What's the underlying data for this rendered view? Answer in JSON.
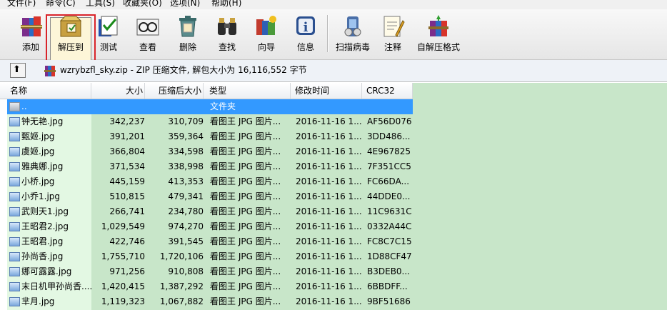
{
  "menu": [
    "文件(F)",
    "命令(C)",
    "工具(S)",
    "收藏夹(O)",
    "选项(N)",
    "帮助(H)"
  ],
  "toolbar": [
    {
      "label": "添加",
      "icon": "add-archive-icon"
    },
    {
      "label": "解压到",
      "icon": "extract-to-icon"
    },
    {
      "label": "测试",
      "icon": "test-icon"
    },
    {
      "label": "查看",
      "icon": "view-icon"
    },
    {
      "label": "删除",
      "icon": "delete-icon"
    },
    {
      "label": "查找",
      "icon": "find-icon"
    },
    {
      "label": "向导",
      "icon": "wizard-icon"
    },
    {
      "label": "信息",
      "icon": "info-icon"
    },
    {
      "label": "扫描病毒",
      "icon": "virus-scan-icon"
    },
    {
      "label": "注释",
      "icon": "comment-icon"
    },
    {
      "label": "自解压格式",
      "icon": "sfx-icon"
    }
  ],
  "address": {
    "text": "wzrybzfl_sky.zip - ZIP 压缩文件, 解包大小为 16,116,552 字节"
  },
  "columns": [
    "名称",
    "大小",
    "压缩后大小",
    "类型",
    "修改时间",
    "CRC32"
  ],
  "parent_row": {
    "name": "..",
    "type": "文件夹"
  },
  "files": [
    {
      "name": "钟无艳.jpg",
      "size": "342,237",
      "packed": "310,709",
      "type": "看图王 JPG 图片...",
      "modified": "2016-11-16 1...",
      "crc": "AF56D076"
    },
    {
      "name": "甄姬.jpg",
      "size": "391,201",
      "packed": "359,364",
      "type": "看图王 JPG 图片...",
      "modified": "2016-11-16 1...",
      "crc": "3DD486..."
    },
    {
      "name": "虞姬.jpg",
      "size": "366,804",
      "packed": "334,598",
      "type": "看图王 JPG 图片...",
      "modified": "2016-11-16 1...",
      "crc": "4E967825"
    },
    {
      "name": "雅典娜.jpg",
      "size": "371,534",
      "packed": "338,998",
      "type": "看图王 JPG 图片...",
      "modified": "2016-11-16 1...",
      "crc": "7F351CC5"
    },
    {
      "name": "小桥.jpg",
      "size": "445,159",
      "packed": "413,353",
      "type": "看图王 JPG 图片...",
      "modified": "2016-11-16 1...",
      "crc": "FC66DA..."
    },
    {
      "name": "小乔1.jpg",
      "size": "510,815",
      "packed": "479,341",
      "type": "看图王 JPG 图片...",
      "modified": "2016-11-16 1...",
      "crc": "44DDE0..."
    },
    {
      "name": "武则天1.jpg",
      "size": "266,741",
      "packed": "234,780",
      "type": "看图王 JPG 图片...",
      "modified": "2016-11-16 1...",
      "crc": "11C9631C"
    },
    {
      "name": "王昭君2.jpg",
      "size": "1,029,549",
      "packed": "974,270",
      "type": "看图王 JPG 图片...",
      "modified": "2016-11-16 1...",
      "crc": "0332A44C"
    },
    {
      "name": "王昭君.jpg",
      "size": "422,746",
      "packed": "391,545",
      "type": "看图王 JPG 图片...",
      "modified": "2016-11-16 1...",
      "crc": "FC8C7C15"
    },
    {
      "name": "孙尚香.jpg",
      "size": "1,755,710",
      "packed": "1,720,106",
      "type": "看图王 JPG 图片...",
      "modified": "2016-11-16 1...",
      "crc": "1D88CF47"
    },
    {
      "name": "娜可露露.jpg",
      "size": "971,256",
      "packed": "910,808",
      "type": "看图王 JPG 图片...",
      "modified": "2016-11-16 1...",
      "crc": "B3DEB0..."
    },
    {
      "name": "末日机甲孙尚香....",
      "size": "1,420,415",
      "packed": "1,387,292",
      "type": "看图王 JPG 图片...",
      "modified": "2016-11-16 1...",
      "crc": "6BBDFF..."
    },
    {
      "name": "芈月.jpg",
      "size": "1,119,323",
      "packed": "1,067,882",
      "type": "看图王 JPG 图片...",
      "modified": "2016-11-16 1...",
      "crc": "9BF51686"
    }
  ]
}
